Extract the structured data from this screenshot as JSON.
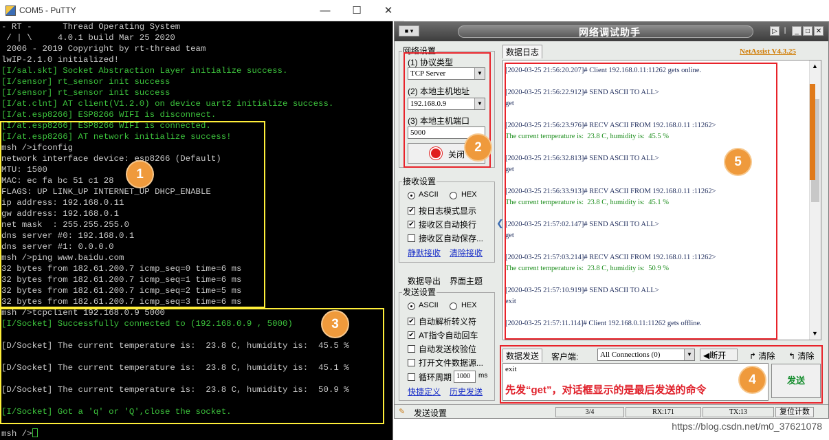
{
  "putty": {
    "title": "COM5 - PuTTY",
    "terminal_lines": [
      {
        "text": "- RT -      Thread Operating System",
        "c": "w"
      },
      {
        "text": " / | \\     4.0.1 build Mar 25 2020",
        "c": "w"
      },
      {
        "text": " 2006 - 2019 Copyright by rt-thread team",
        "c": "w"
      },
      {
        "text": "lwIP-2.1.0 initialized!",
        "c": "w"
      },
      {
        "text": "[I/sal.skt] Socket Abstraction Layer initialize success.",
        "c": "g"
      },
      {
        "text": "[I/sensor] rt_sensor init success",
        "c": "g"
      },
      {
        "text": "[I/sensor] rt_sensor init success",
        "c": "g"
      },
      {
        "text": "[I/at.clnt] AT client(V1.2.0) on device uart2 initialize success.",
        "c": "g"
      },
      {
        "text": "[I/at.esp8266] ESP8266 WIFI is disconnect.",
        "c": "g"
      },
      {
        "text": "[I/at.esp8266] ESP8266 WIFI is connected.",
        "c": "g"
      },
      {
        "text": "[I/at.esp8266] AT network initialize success!",
        "c": "g"
      },
      {
        "text": "msh />ifconfig",
        "c": "w"
      },
      {
        "text": "network interface device: esp8266 (Default)",
        "c": "w"
      },
      {
        "text": "MTU: 1500",
        "c": "w"
      },
      {
        "text": "MAC: ec fa bc 51 c1 28",
        "c": "w"
      },
      {
        "text": "FLAGS: UP LINK_UP INTERNET_UP DHCP_ENABLE",
        "c": "w"
      },
      {
        "text": "ip address: 192.168.0.11",
        "c": "w"
      },
      {
        "text": "gw address: 192.168.0.1",
        "c": "w"
      },
      {
        "text": "net mask  : 255.255.255.0",
        "c": "w"
      },
      {
        "text": "dns server #0: 192.168.0.1",
        "c": "w"
      },
      {
        "text": "dns server #1: 0.0.0.0",
        "c": "w"
      },
      {
        "text": "msh />ping www.baidu.com",
        "c": "w"
      },
      {
        "text": "32 bytes from 182.61.200.7 icmp_seq=0 time=6 ms",
        "c": "w"
      },
      {
        "text": "32 bytes from 182.61.200.7 icmp_seq=1 time=6 ms",
        "c": "w"
      },
      {
        "text": "32 bytes from 182.61.200.7 icmp_seq=2 time=5 ms",
        "c": "w"
      },
      {
        "text": "32 bytes from 182.61.200.7 icmp_seq=3 time=6 ms",
        "c": "w"
      },
      {
        "text": "msh />tcpclient 192.168.0.9 5000",
        "c": "w"
      },
      {
        "text": "[I/Socket] Successfully connected to (192.168.0.9 , 5000)",
        "c": "g"
      },
      {
        "text": "",
        "c": "w"
      },
      {
        "text": "[D/Socket] The current temperature is:  23.8 C, humidity is:  45.5 %",
        "c": "w"
      },
      {
        "text": "",
        "c": "w"
      },
      {
        "text": "[D/Socket] The current temperature is:  23.8 C, humidity is:  45.1 %",
        "c": "w"
      },
      {
        "text": "",
        "c": "w"
      },
      {
        "text": "[D/Socket] The current temperature is:  23.8 C, humidity is:  50.9 %",
        "c": "w"
      },
      {
        "text": "",
        "c": "w"
      },
      {
        "text": "[I/Socket] Got a 'q' or 'Q',close the socket.",
        "c": "g"
      },
      {
        "text": "",
        "c": "w"
      },
      {
        "text": "msh />",
        "c": "w"
      }
    ]
  },
  "netassist": {
    "title": "网络调试助手",
    "net_settings": "网络设置",
    "protocol_label": "(1) 协议类型",
    "protocol_value": "TCP Server",
    "host_label": "(2) 本地主机地址",
    "host_value": "192.168.0.9",
    "port_label": "(3) 本地主机端口",
    "port_value": "5000",
    "close_btn": "关闭",
    "recv_settings": "接收设置",
    "ascii": "ASCII",
    "hex": "HEX",
    "recv_opts": [
      "按日志模式显示",
      "接收区自动换行",
      "接收区自动保存..."
    ],
    "recv_opts_checked": [
      true,
      true,
      false
    ],
    "mute_recv": "静默接收",
    "clear_recv": "清除接收",
    "data_export": "数据导出",
    "ui_theme": "界面主题",
    "send_settings": "发送设置",
    "send_opts": [
      "自动解析转义符",
      "AT指令自动回车",
      "自动发送校验位",
      "打开文件数据源..."
    ],
    "send_opts_checked": [
      true,
      true,
      false,
      false
    ],
    "loop_label": "循环周期",
    "loop_value": "1000",
    "loop_unit": "ms",
    "shortcut": "快捷定义",
    "history": "历史发送",
    "log_tab": "数据日志",
    "brand": "NetAssist V4.3.25",
    "log": [
      {
        "t": "[2020-03-25 21:56:20.207]# Client 192.168.0.11:11262 gets online.",
        "k": "i"
      },
      {
        "t": "[2020-03-25 21:56:22.912]# SEND ASCII TO ALL>",
        "k": "i"
      },
      {
        "t": "get",
        "k": "i"
      },
      {
        "t": "[2020-03-25 21:56:23.976]# RECV ASCII FROM 192.168.0.11 :11262>",
        "k": "i"
      },
      {
        "t": "The current temperature is:  23.8 C, humidity is:  45.5 %",
        "k": "r"
      },
      {
        "t": "[2020-03-25 21:56:32.813]# SEND ASCII TO ALL>",
        "k": "i"
      },
      {
        "t": "get",
        "k": "i"
      },
      {
        "t": "[2020-03-25 21:56:33.913]# RECV ASCII FROM 192.168.0.11 :11262>",
        "k": "i"
      },
      {
        "t": "The current temperature is:  23.8 C, humidity is:  45.1 %",
        "k": "r"
      },
      {
        "t": "[2020-03-25 21:57:02.147]# SEND ASCII TO ALL>",
        "k": "i"
      },
      {
        "t": "get",
        "k": "i"
      },
      {
        "t": "[2020-03-25 21:57:03.214]# RECV ASCII FROM 192.168.0.11 :11262>",
        "k": "i"
      },
      {
        "t": "The current temperature is:  23.8 C, humidity is:  50.9 %",
        "k": "r"
      },
      {
        "t": "[2020-03-25 21:57:10.919]# SEND ASCII TO ALL>",
        "k": "i"
      },
      {
        "t": "exit",
        "k": "i"
      },
      {
        "t": "[2020-03-25 21:57:11.114]# Client 192.168.0.11:11262 gets offline.",
        "k": "i"
      }
    ],
    "send_tab": "数据发送",
    "client_label": "客户端:",
    "client_value": "All Connections (0)",
    "disconnect": "断开",
    "clear1": "清除",
    "clear2": "清除",
    "send_text": "exit",
    "send_btn": "发送",
    "annotation": "先发“get”，对话框显示的是最后发送的命令",
    "status_settings": "发送设置",
    "status_count": "3/4",
    "rx": "RX:171",
    "tx": "TX:13",
    "reset": "复位计数"
  },
  "badges": [
    "1",
    "2",
    "3",
    "4",
    "5"
  ],
  "watermark": "https://blog.csdn.net/m0_37621078",
  "colors": {
    "terminal_bg": "#000000",
    "terminal_green": "#3cc23c",
    "highlight_yellow": "#ffef3a",
    "highlight_red": "#e8232a",
    "badge_orange": "#ef9a3c"
  }
}
